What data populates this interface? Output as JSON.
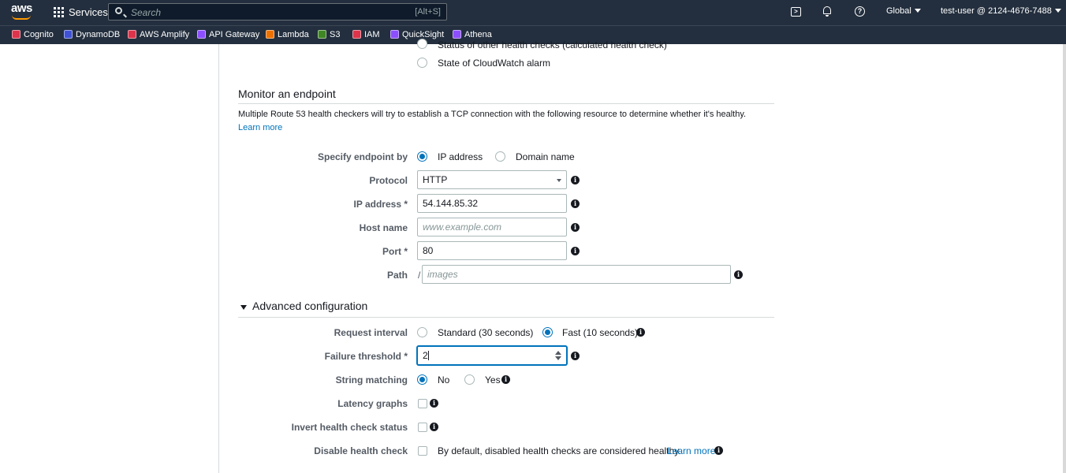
{
  "topnav": {
    "logo": "aws",
    "services_label": "Services",
    "search_placeholder": "Search",
    "search_shortcut": "[Alt+S]",
    "region_label": "Global",
    "account_label": "test-user @ 2124-4676-7488"
  },
  "favorites": [
    {
      "label": "Cognito",
      "color": "#dd344c"
    },
    {
      "label": "DynamoDB",
      "color": "#4053d6"
    },
    {
      "label": "AWS Amplify",
      "color": "#dd344c"
    },
    {
      "label": "API Gateway",
      "color": "#8c4fff"
    },
    {
      "label": "Lambda",
      "color": "#ed7100"
    },
    {
      "label": "S3",
      "color": "#3f8624"
    },
    {
      "label": "IAM",
      "color": "#dd344c"
    },
    {
      "label": "QuickSight",
      "color": "#8c4fff"
    },
    {
      "label": "Athena",
      "color": "#8c4fff"
    }
  ],
  "form": {
    "partial_option_label": "Status of other health checks (calculated health check)",
    "cloudwatch_option_label": "State of CloudWatch alarm",
    "monitor_section_title": "Monitor an endpoint",
    "monitor_description": "Multiple Route 53 health checkers will try to establish a TCP connection with the following resource to determine whether it's healthy.",
    "learn_more": "Learn more",
    "specify_endpoint_label": "Specify endpoint by",
    "ip_address_option": "IP address",
    "domain_name_option": "Domain name",
    "protocol_label": "Protocol",
    "protocol_value": "HTTP",
    "ip_address_label": "IP address *",
    "ip_address_value": "54.144.85.32",
    "host_name_label": "Host name",
    "host_name_placeholder": "www.example.com",
    "port_label": "Port *",
    "port_value": "80",
    "path_label": "Path",
    "path_prefix": "/",
    "path_placeholder": "images",
    "advanced_title": "Advanced configuration",
    "request_interval_label": "Request interval",
    "standard_option": "Standard (30 seconds)",
    "fast_option": "Fast (10 seconds)",
    "failure_threshold_label": "Failure threshold *",
    "failure_threshold_value": "2",
    "string_matching_label": "String matching",
    "no_option": "No",
    "yes_option": "Yes",
    "latency_graphs_label": "Latency graphs",
    "invert_label": "Invert health check status",
    "disable_label": "Disable health check",
    "disable_description": "By default, disabled health checks are considered healthy.",
    "disable_learn_more": "Learn more",
    "info_glyph": "i"
  },
  "colors": {
    "nav_bg": "#232f3e",
    "accent": "#0073bb",
    "focus_border": "#0073bb"
  }
}
